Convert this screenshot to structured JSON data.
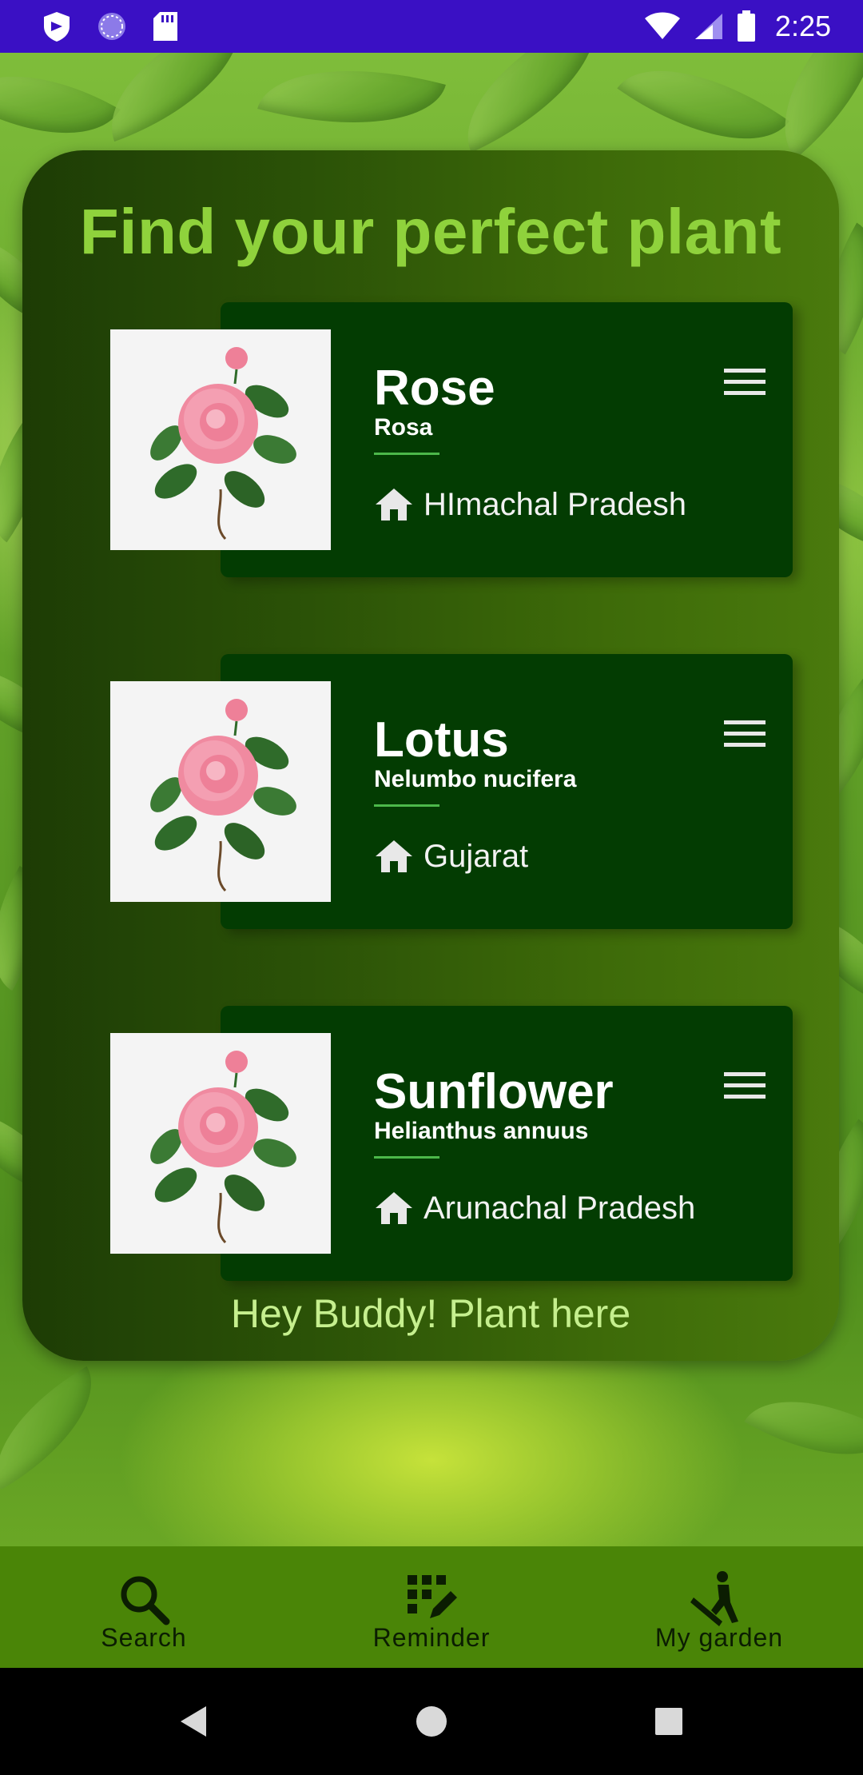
{
  "status_bar": {
    "time": "2:25",
    "icons": [
      "shield-icon",
      "sync-circle-icon",
      "sd-card-icon",
      "wifi-icon",
      "signal-icon",
      "battery-icon"
    ]
  },
  "header": {
    "title": "Find your perfect plant"
  },
  "plants": [
    {
      "name": "Rose",
      "scientific": "Rosa",
      "location": "HImachal Pradesh",
      "location_icon": "home-icon",
      "menu_icon": "menu-icon"
    },
    {
      "name": "Lotus",
      "scientific": "Nelumbo nucifera",
      "location": "Gujarat",
      "location_icon": "home-icon",
      "menu_icon": "menu-icon"
    },
    {
      "name": "Sunflower",
      "scientific": "Helianthus annuus",
      "location": "Arunachal Pradesh",
      "location_icon": "home-icon",
      "menu_icon": "menu-icon"
    }
  ],
  "footer": {
    "text": "Hey Buddy! Plant here"
  },
  "bottom_nav": {
    "items": [
      {
        "label": "Search",
        "icon": "search-icon"
      },
      {
        "label": "Reminder",
        "icon": "reminder-grid-icon"
      },
      {
        "label": "My garden",
        "icon": "gardener-icon"
      }
    ]
  },
  "system_nav": {
    "buttons": [
      "back-icon",
      "home-circle-icon",
      "recents-icon"
    ]
  },
  "colors": {
    "status_bar": "#3a10c4",
    "title": "#8fd23c",
    "card": "#033c02",
    "divider": "#4cb84a",
    "footer_text": "#c5ef8e",
    "bottom_nav": "#4a8507"
  }
}
